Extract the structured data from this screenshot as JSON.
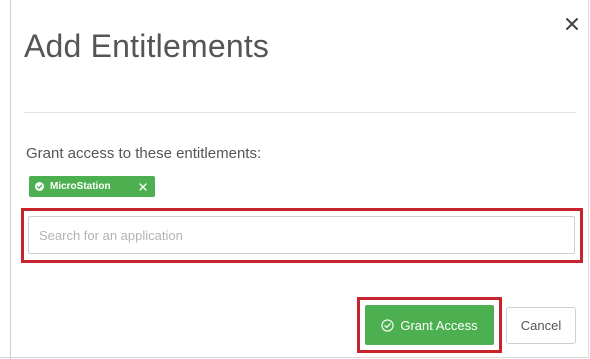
{
  "modal": {
    "title": "Add Entitlements",
    "close_icon": "close-icon"
  },
  "entitlements": {
    "label": "Grant access to these entitlements:",
    "tags": [
      {
        "label": "MicroStation",
        "icon": "check-circle-icon",
        "remove_icon": "close-icon"
      }
    ]
  },
  "search": {
    "placeholder": "Search for an application",
    "value": ""
  },
  "actions": {
    "grant_label": "Grant Access",
    "grant_icon": "check-circle-icon",
    "cancel_label": "Cancel"
  },
  "colors": {
    "accent_green": "#4caf50",
    "highlight_red": "#c9232d",
    "text_gray": "#555555"
  }
}
